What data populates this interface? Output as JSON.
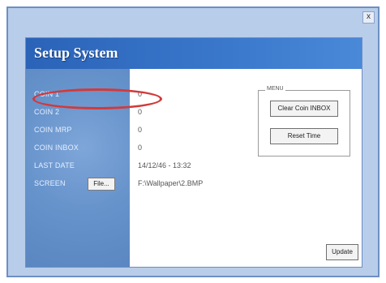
{
  "window": {
    "close_label": "x"
  },
  "dialog": {
    "title": "Setup System",
    "fields": [
      {
        "label": "COIN 1",
        "value": "0"
      },
      {
        "label": "COIN 2",
        "value": "0"
      },
      {
        "label": "COIN MRP",
        "value": "0"
      },
      {
        "label": "COIN INBOX",
        "value": "0"
      },
      {
        "label": "LAST DATE",
        "value": "14/12/46 - 13:32"
      },
      {
        "label": "SCREEN",
        "value": "F:\\Wallpaper\\2.BMP"
      }
    ],
    "file_button_label": "File...",
    "menu": {
      "group_label": "MENU",
      "buttons": [
        "Clear Coin INBOX",
        "Reset Time"
      ]
    },
    "update_label": "Update"
  },
  "colors": {
    "header_blue": "#2a63b8",
    "sidebar_blue": "#6894cc",
    "highlight_red": "#d23a3a"
  }
}
